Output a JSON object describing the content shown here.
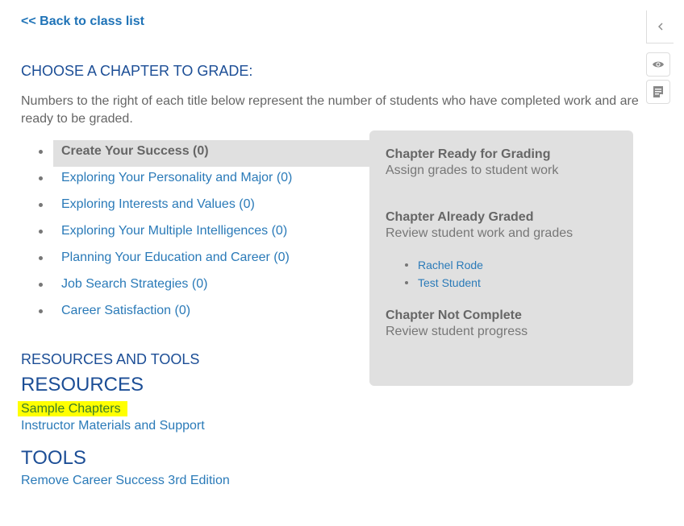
{
  "nav": {
    "back_link": "<< Back to class list"
  },
  "grading": {
    "title": "CHOOSE A CHAPTER TO GRADE:",
    "intro": "Numbers to the right of each title below represent the number of students who have completed work and are ready to be graded.",
    "chapters": [
      {
        "label": "Create Your Success (0)",
        "active": true
      },
      {
        "label": "Exploring Your Personality and Major (0)",
        "active": false
      },
      {
        "label": "Exploring Interests and Values (0)",
        "active": false
      },
      {
        "label": "Exploring Your Multiple Intelligences (0)",
        "active": false
      },
      {
        "label": "Planning Your Education and Career (0)",
        "active": false
      },
      {
        "label": "Job Search Strategies (0)",
        "active": false
      },
      {
        "label": "Career Satisfaction (0)",
        "active": false
      }
    ]
  },
  "legend": {
    "ready": {
      "title": "Chapter Ready for Grading",
      "desc": "Assign grades to student work"
    },
    "graded": {
      "title": "Chapter Already Graded",
      "desc": "Review student work and grades",
      "students": [
        "Rachel Rode",
        "Test Student"
      ]
    },
    "incomplete": {
      "title": "Chapter Not Complete",
      "desc": "Review student progress"
    }
  },
  "resources_tools": {
    "section_title": "RESOURCES AND TOOLS",
    "resources_title": "RESOURCES",
    "resources_links": [
      "Sample Chapters",
      "Instructor Materials and Support"
    ],
    "tools_title": "TOOLS",
    "tools_links": [
      "Remove Career Success 3rd Edition"
    ]
  },
  "side_toolbar": {
    "collapse_icon": "chevron-left-icon",
    "buttons": [
      "eye-icon",
      "notes-icon"
    ]
  },
  "colors": {
    "link": "#2a7ab8",
    "heading": "#1c4e96",
    "panel_bg": "#e0e0e0",
    "highlight": "#ffff00"
  }
}
